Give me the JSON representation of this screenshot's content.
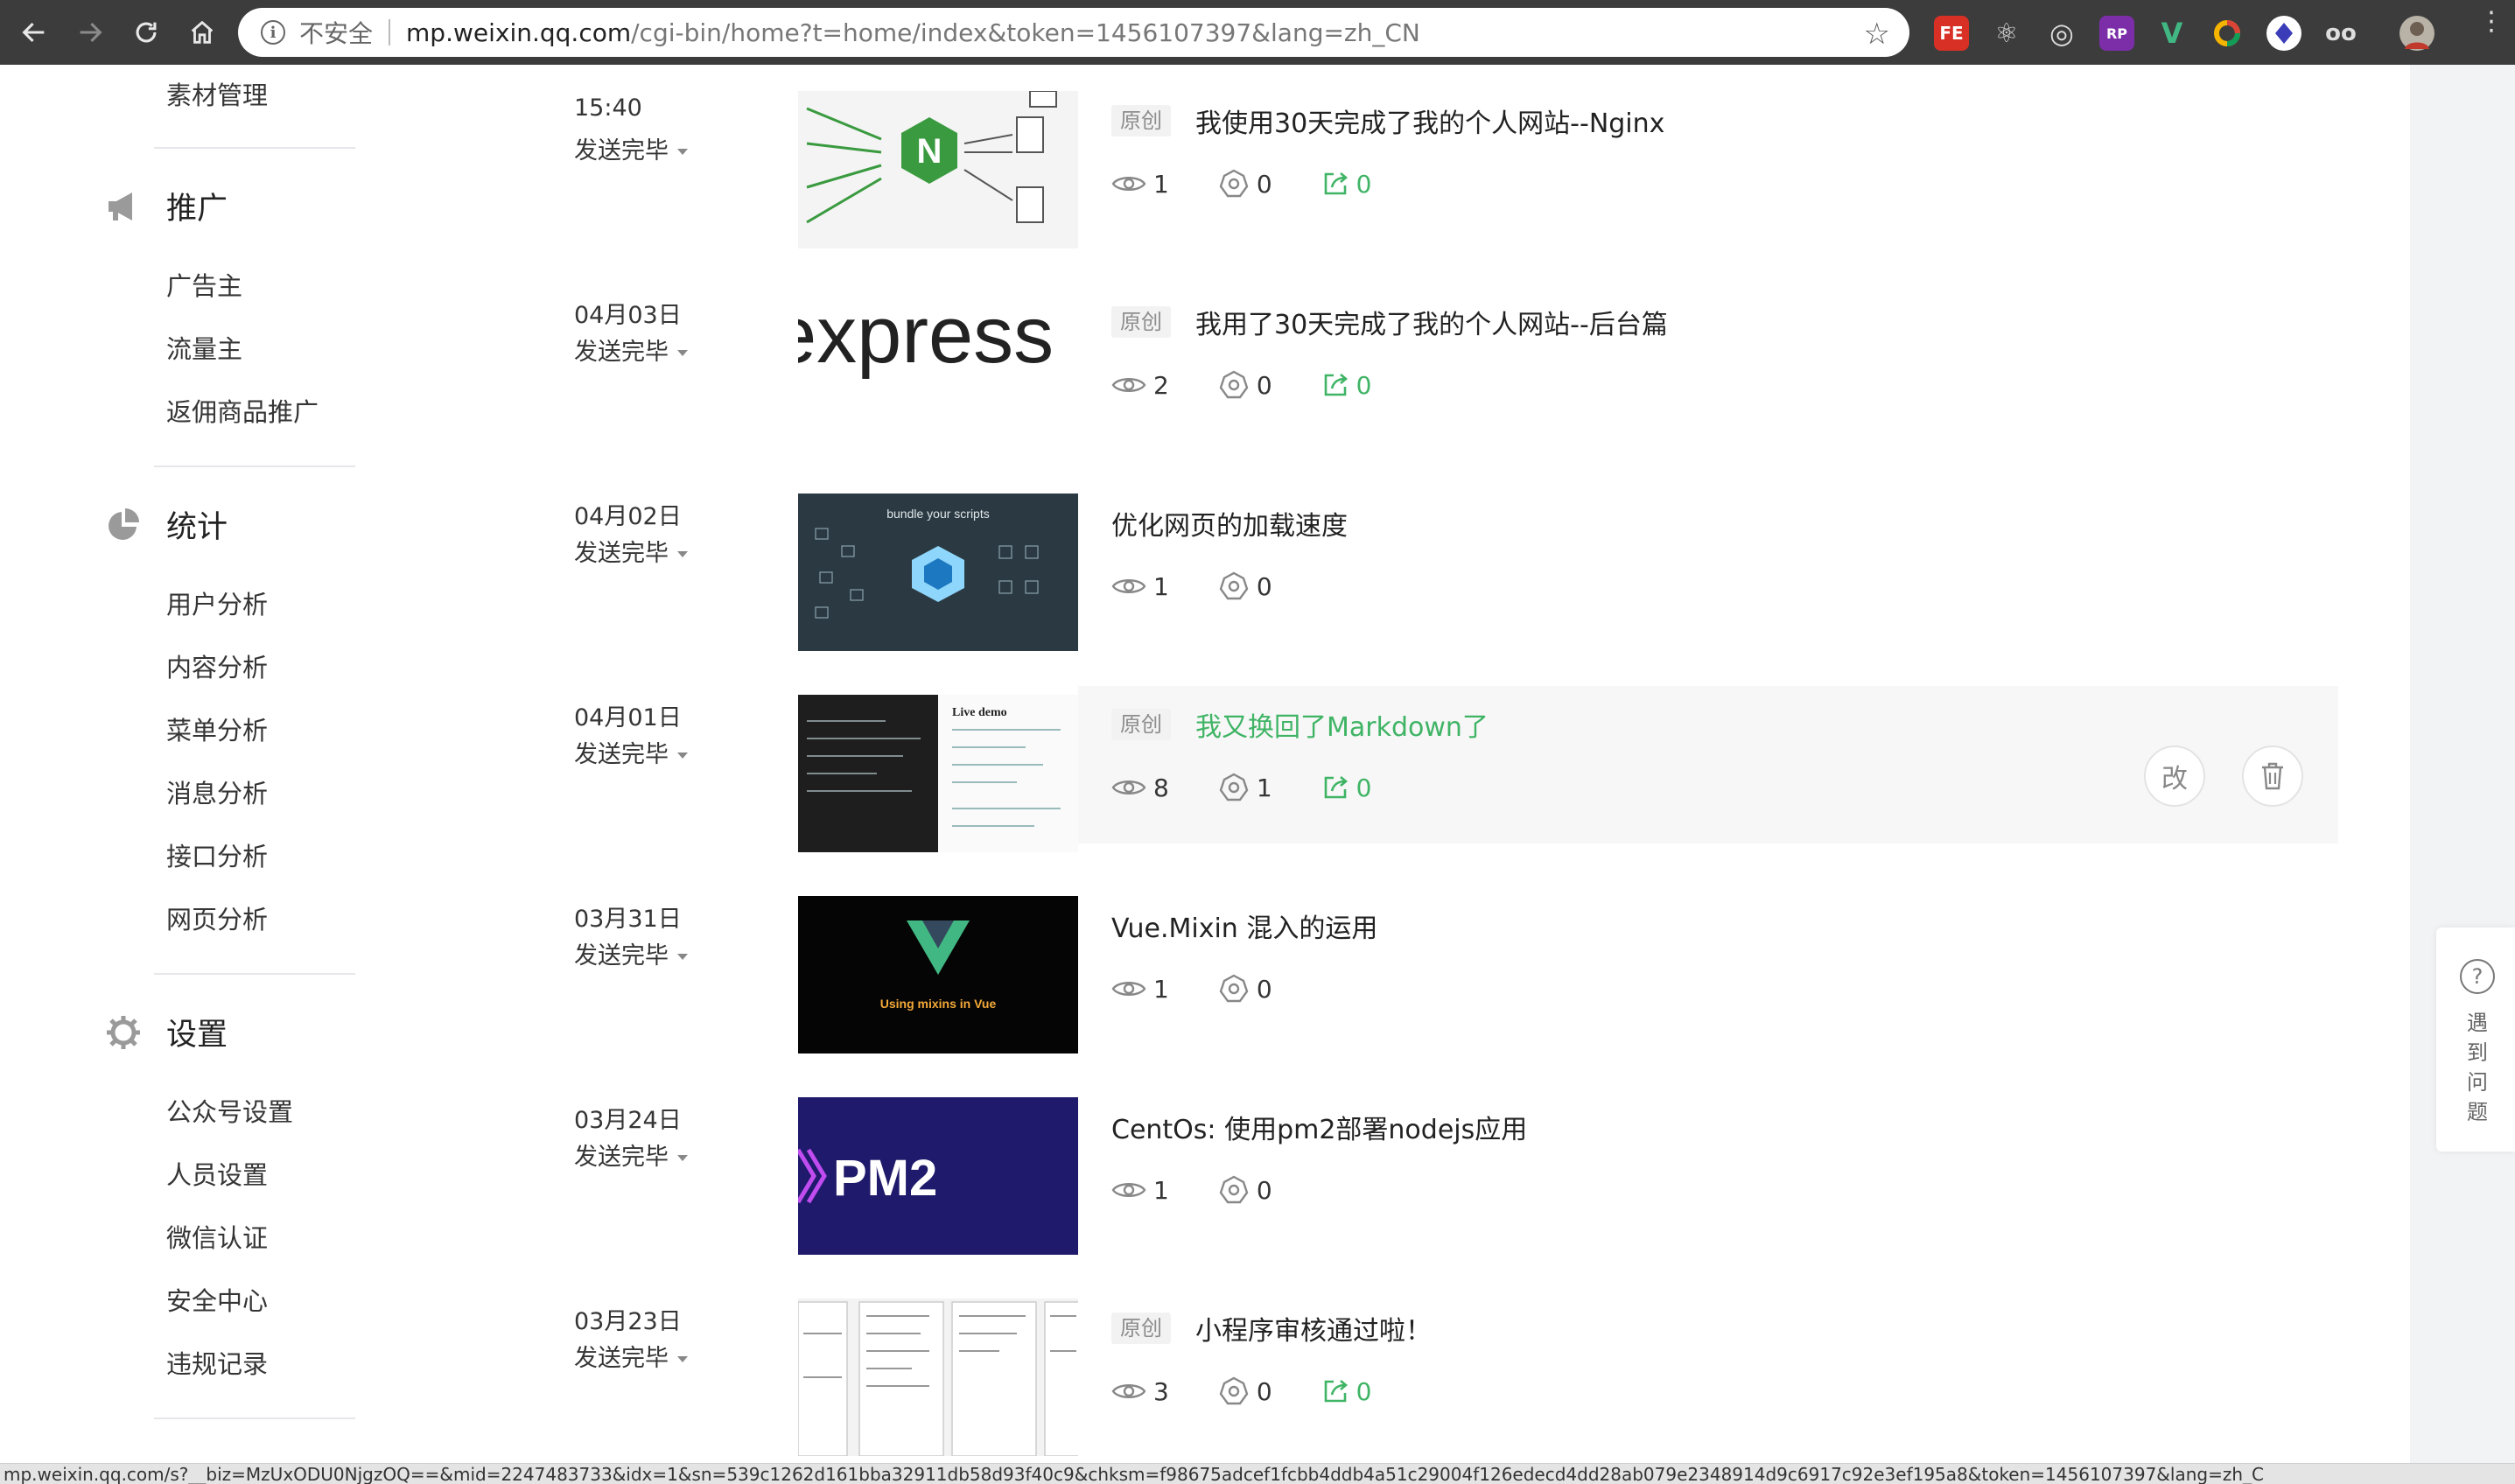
{
  "browser": {
    "security_text": "不安全",
    "url_host": "mp.weixin.qq.com",
    "url_path": "/cgi-bin/home?t=home/index&token=1456107397&lang=zh_CN",
    "status_url": "mp.weixin.qq.com/s?__biz=MzUxODU0NjgzOQ==&mid=2247483733&idx=1&sn=539c1262d161bba32911db58d93f40c9&chksm=f98675adcef1fcbb4ddb4a51c29004f126edecd4dd28ab079e2348914d9c6917c92e3ef195a8&token=1456107397&lang=zh_C"
  },
  "sidebar": {
    "top_item": "素材管理",
    "groups": [
      {
        "title": "推广",
        "icon": "megaphone-icon",
        "items": [
          "广告主",
          "流量主",
          "返佣商品推广"
        ]
      },
      {
        "title": "统计",
        "icon": "pie-chart-icon",
        "items": [
          "用户分析",
          "内容分析",
          "菜单分析",
          "消息分析",
          "接口分析",
          "网页分析"
        ]
      },
      {
        "title": "设置",
        "icon": "gear-icon",
        "items": [
          "公众号设置",
          "人员设置",
          "微信认证",
          "安全中心",
          "违规记录"
        ]
      }
    ]
  },
  "posts": [
    {
      "date": "15:40",
      "status": "发送完毕",
      "original": "原创",
      "title": "我使用30天完成了我的个人网站--Nginx",
      "views": "1",
      "likes": "0",
      "shares": "0"
    },
    {
      "date": "04月03日",
      "status": "发送完毕",
      "original": "原创",
      "title": "我用了30天完成了我的个人网站--后台篇",
      "views": "2",
      "likes": "0",
      "shares": "0"
    },
    {
      "date": "04月02日",
      "status": "发送完毕",
      "original": "",
      "title": "优化网页的加载速度",
      "views": "1",
      "likes": "0",
      "shares": ""
    },
    {
      "date": "04月01日",
      "status": "发送完毕",
      "original": "原创",
      "title": "我又换回了Markdown了",
      "views": "8",
      "likes": "1",
      "shares": "0"
    },
    {
      "date": "03月31日",
      "status": "发送完毕",
      "original": "",
      "title": "Vue.Mixin 混入的运用",
      "views": "1",
      "likes": "0",
      "shares": ""
    },
    {
      "date": "03月24日",
      "status": "发送完毕",
      "original": "",
      "title": "CentOs: 使用pm2部署nodejs应用",
      "views": "1",
      "likes": "0",
      "shares": ""
    },
    {
      "date": "03月23日",
      "status": "发送完毕",
      "original": "原创",
      "title": "小程序审核通过啦！",
      "views": "3",
      "likes": "0",
      "shares": "0"
    }
  ],
  "thumbs": {
    "express_word": "express",
    "webpack_caption": "bundle your scripts",
    "markdown_heading": "Live demo",
    "vue_caption": "Using mixins in Vue",
    "pm2_word": "PM2",
    "nginx_letter": "N"
  },
  "actions": {
    "edit_label": "改",
    "delete_icon": "trash-icon"
  },
  "help": {
    "text": "遇到问题"
  },
  "colors": {
    "accent_green": "#3fb465",
    "nginx_green": "#3a9a3f",
    "vue_green": "#41b883",
    "pm2_bg": "#1f1a6b"
  }
}
